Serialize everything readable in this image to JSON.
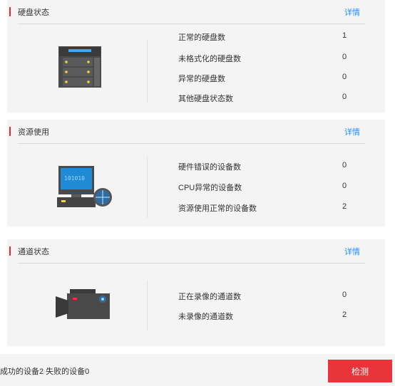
{
  "disk": {
    "title": "硬盘状态",
    "detail": "详情",
    "icon": "disk-server-icon",
    "stats": [
      {
        "label": "正常的硬盘数",
        "value": "1"
      },
      {
        "label": "未格式化的硬盘数",
        "value": "0"
      },
      {
        "label": "异常的硬盘数",
        "value": "0"
      },
      {
        "label": "其他硬盘状态数",
        "value": "0"
      }
    ]
  },
  "resource": {
    "title": "资源使用",
    "detail": "详情",
    "icon": "computer-monitor-icon",
    "stats": [
      {
        "label": "硬件错误的设备数",
        "value": "0"
      },
      {
        "label": "CPU异常的设备数",
        "value": "0"
      },
      {
        "label": "资源使用正常的设备数",
        "value": "2"
      }
    ]
  },
  "channel": {
    "title": "通道状态",
    "detail": "详情",
    "icon": "video-camera-icon",
    "stats": [
      {
        "label": "正在录像的通道数",
        "value": "0"
      },
      {
        "label": "未录像的通道数",
        "value": "2"
      }
    ]
  },
  "footer": {
    "summary": "成功的设备2 失败的设备0",
    "check_label": "检测"
  },
  "colors": {
    "accent_red": "#e9343a",
    "link_blue": "#1e90ff",
    "card_bg": "#f4f4f4"
  }
}
